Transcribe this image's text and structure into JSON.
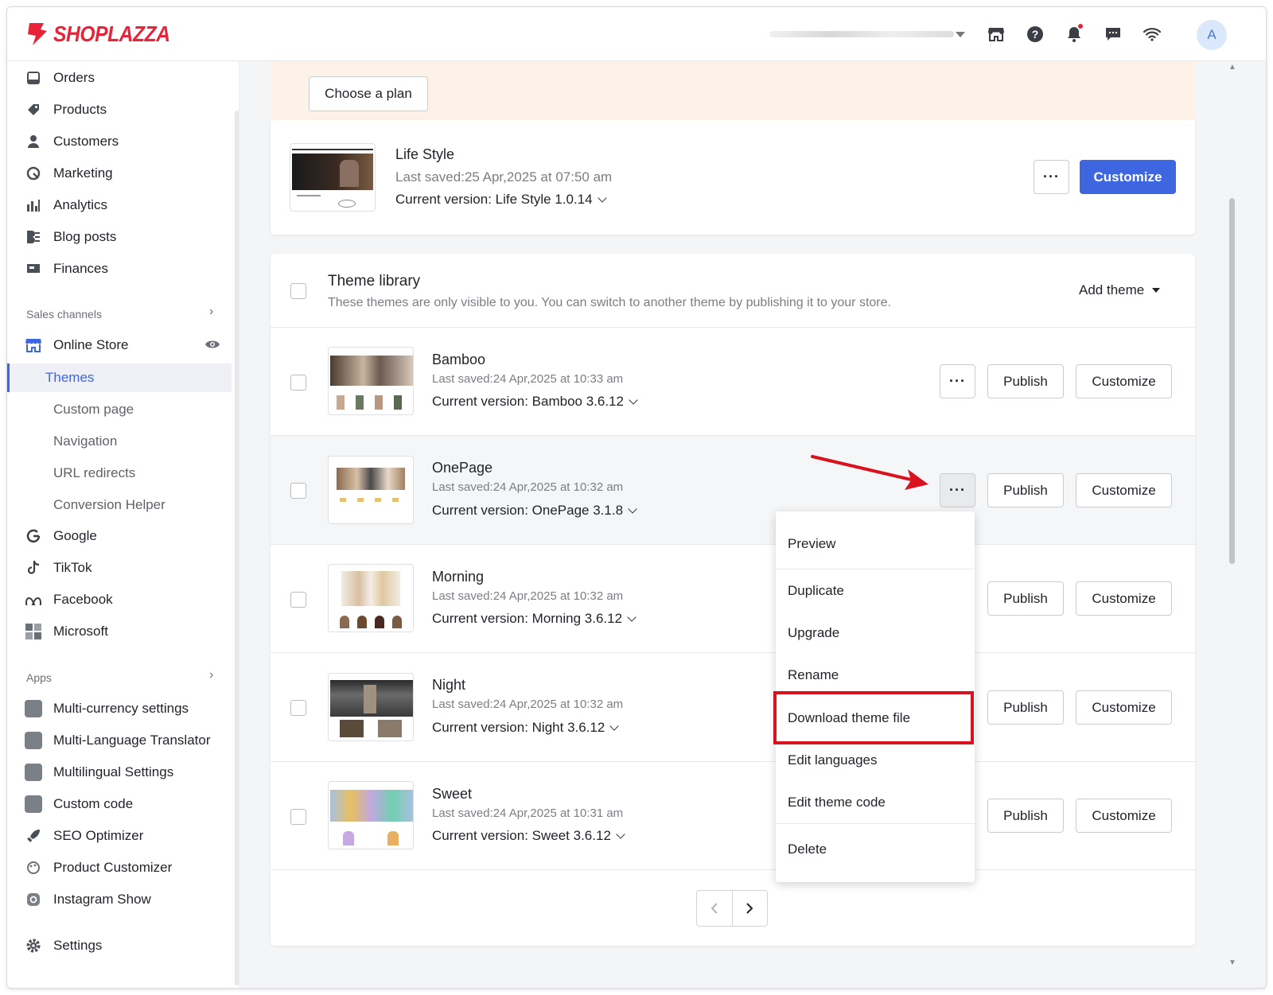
{
  "brand": {
    "name": "SHOPLAZZA",
    "color": "#e8243a"
  },
  "topbar": {
    "icons": [
      "store-icon",
      "help-icon",
      "bell-icon",
      "chat-icon",
      "wifi-icon"
    ],
    "avatar_initial": "A"
  },
  "sidebar": {
    "main_items": [
      {
        "label": "Orders",
        "icon": "orders-icon"
      },
      {
        "label": "Products",
        "icon": "tag-icon"
      },
      {
        "label": "Customers",
        "icon": "person-icon"
      },
      {
        "label": "Marketing",
        "icon": "marketing-icon"
      },
      {
        "label": "Analytics",
        "icon": "bar-chart-icon"
      },
      {
        "label": "Blog posts",
        "icon": "blog-icon"
      },
      {
        "label": "Finances",
        "icon": "finances-icon"
      }
    ],
    "sales_channels_title": "Sales channels",
    "online_store": {
      "label": "Online Store",
      "icon": "store-icon"
    },
    "online_store_sub": [
      "Themes",
      "Custom page",
      "Navigation",
      "URL redirects",
      "Conversion Helper"
    ],
    "channels": [
      {
        "label": "Google",
        "icon": "google-icon"
      },
      {
        "label": "TikTok",
        "icon": "tiktok-icon"
      },
      {
        "label": "Facebook",
        "icon": "meta-icon"
      },
      {
        "label": "Microsoft",
        "icon": "microsoft-icon"
      }
    ],
    "apps_title": "Apps",
    "apps": [
      {
        "label": "Multi-currency settings"
      },
      {
        "label": "Multi-Language Translator"
      },
      {
        "label": "Multilingual Settings"
      },
      {
        "label": "Custom code"
      },
      {
        "label": "SEO Optimizer"
      },
      {
        "label": "Product Customizer"
      },
      {
        "label": "Instagram Show"
      }
    ],
    "settings": "Settings"
  },
  "banner": {
    "button": "Choose a plan"
  },
  "current_theme": {
    "name": "Life Style",
    "saved": "Last saved:25 Apr,2025 at 07:50 am",
    "version": "Current version: Life Style 1.0.14",
    "more": "···",
    "customize": "Customize"
  },
  "library": {
    "title": "Theme library",
    "subtitle": "These themes are only visible to you. You can switch to another theme by publishing it to your store.",
    "add_theme": "Add theme",
    "publish_label": "Publish",
    "customize_label": "Customize",
    "themes": [
      {
        "name": "Bamboo",
        "saved": "Last saved:24 Apr,2025 at 10:33 am",
        "version": "Current version: Bamboo 3.6.12"
      },
      {
        "name": "OnePage",
        "saved": "Last saved:24 Apr,2025 at 10:32 am",
        "version": "Current version: OnePage 3.1.8"
      },
      {
        "name": "Morning",
        "saved": "Last saved:24 Apr,2025 at 10:32 am",
        "version": "Current version: Morning 3.6.12"
      },
      {
        "name": "Night",
        "saved": "Last saved:24 Apr,2025 at 10:32 am",
        "version": "Current version: Night 3.6.12"
      },
      {
        "name": "Sweet",
        "saved": "Last saved:24 Apr,2025 at 10:31 am",
        "version": "Current version: Sweet 3.6.12"
      }
    ]
  },
  "menu": {
    "items": [
      "Preview",
      "Duplicate",
      "Upgrade",
      "Rename",
      "Download theme file",
      "Edit languages",
      "Edit theme code",
      "Delete"
    ],
    "highlighted": "Download theme file"
  },
  "colors": {
    "accent": "#3e66e0",
    "annotation": "#d9121f"
  }
}
